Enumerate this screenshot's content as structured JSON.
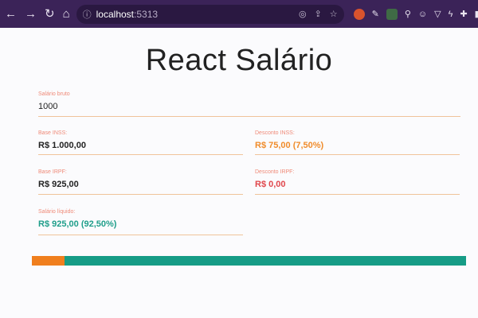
{
  "browser": {
    "url_host": "localhost",
    "url_port": ":5313"
  },
  "app": {
    "title": "React Salário",
    "salario_bruto": {
      "label": "Salário bruto",
      "value": "1000"
    },
    "base_inss": {
      "label": "Base INSS:",
      "value": "R$ 1.000,00"
    },
    "desconto_inss": {
      "label": "Desconto INSS:",
      "value": "R$ 75,00 (7,50%)"
    },
    "base_irpf": {
      "label": "Base IRPF:",
      "value": "R$ 925,00"
    },
    "desconto_irpf": {
      "label": "Desconto IRPF:",
      "value": "R$ 0,00"
    },
    "salario_liquido": {
      "label": "Salário líquido:",
      "value": "R$ 925,00 (92,50%)"
    },
    "bar": {
      "inss_percent": 7.5,
      "irpf_percent": 0,
      "liquido_percent": 92.5,
      "colors": {
        "inss": "#f07f1e",
        "irpf": "#e0474c",
        "liquido": "#169c86"
      }
    }
  }
}
